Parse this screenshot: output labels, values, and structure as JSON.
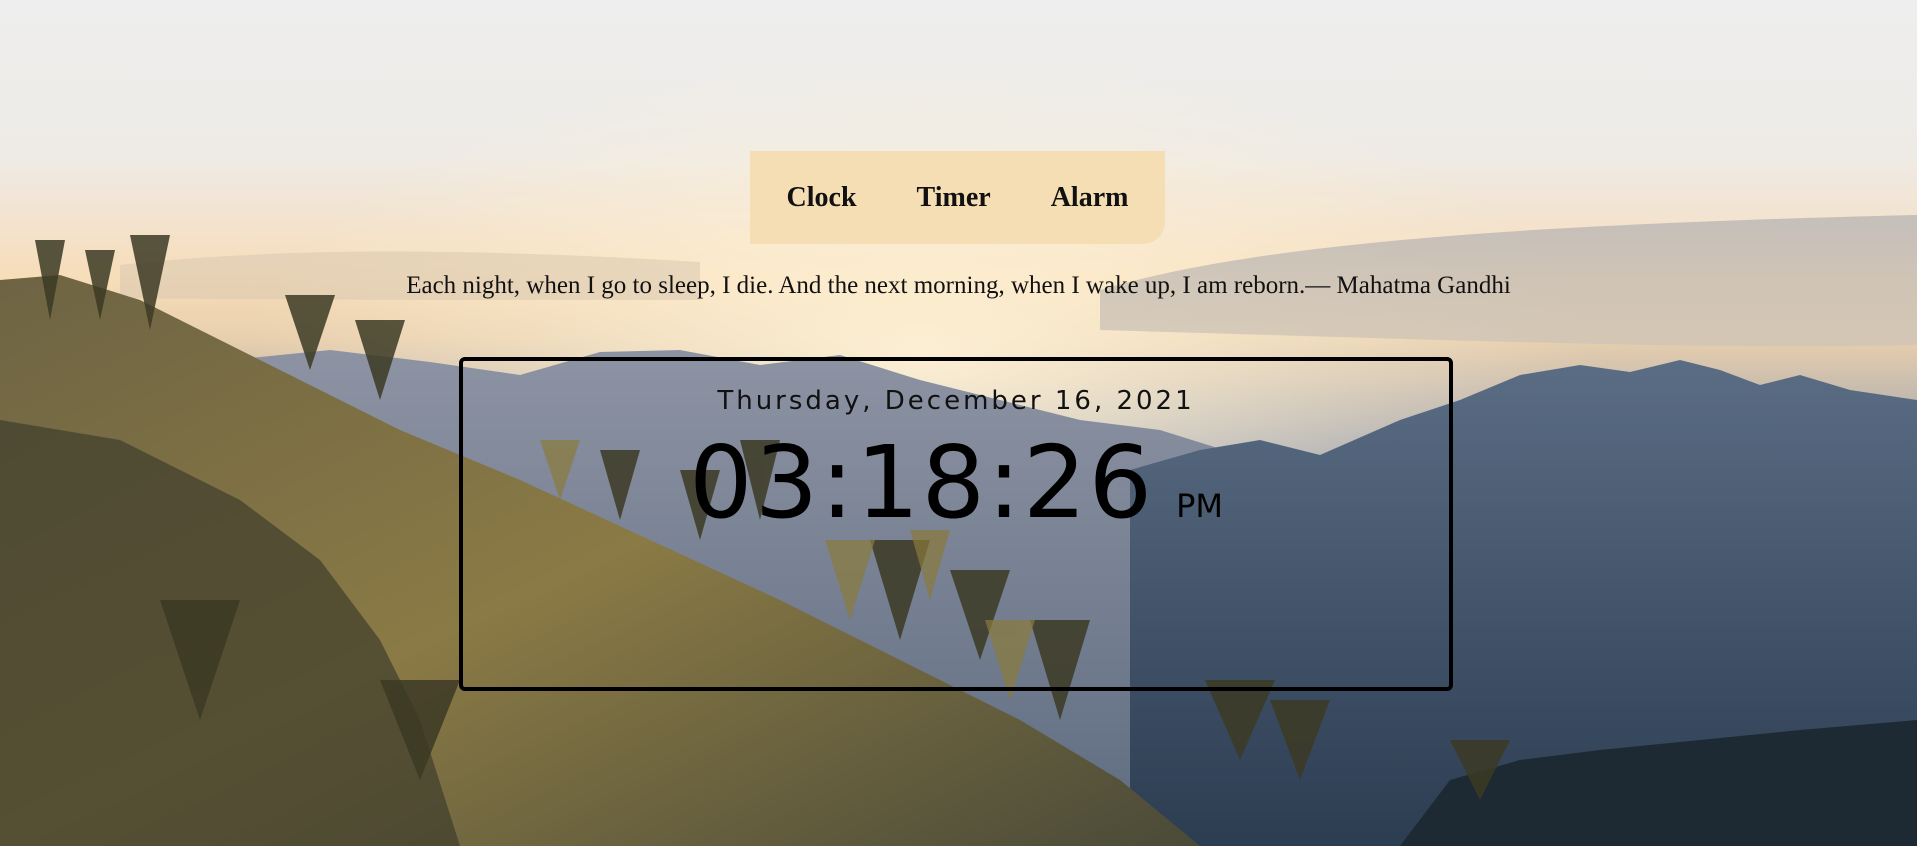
{
  "tabs": [
    {
      "label": "Clock"
    },
    {
      "label": "Timer"
    },
    {
      "label": "Alarm"
    }
  ],
  "quote": "Each night, when I go to sleep, I die. And the next morning, when I wake up, I am reborn.— Mahatma Gandhi",
  "clock": {
    "date": "Thursday, December 16, 2021",
    "time": "03:18:26",
    "period": "PM"
  },
  "colors": {
    "tab_bar": "#f5deb3",
    "clock_border": "#000000"
  }
}
